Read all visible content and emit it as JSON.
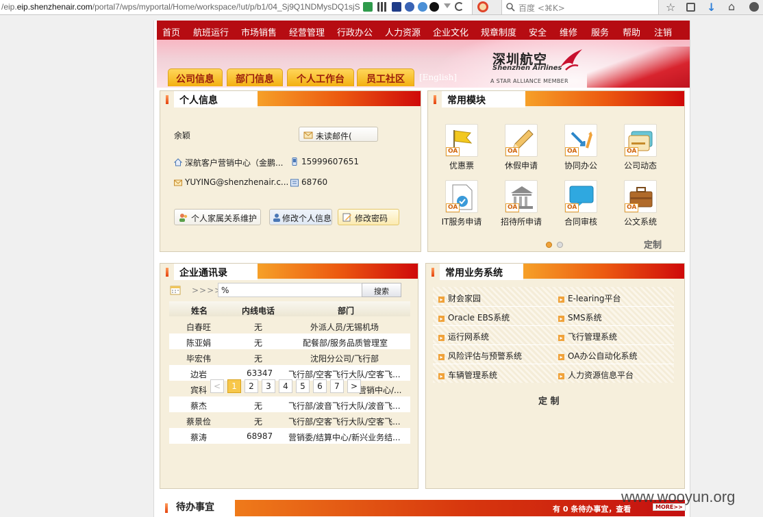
{
  "browser": {
    "url_host": "eip.shenzhenair.com",
    "url_prefix": "/eip.",
    "url_path": "/portal7/wps/myportal/Home/workspace/!ut/p/b1/04_Sj9Q1NDMysDQ1sjS",
    "search_placeholder": "百度 <⌘K>"
  },
  "nav": [
    "首页",
    "航班运行",
    "市场销售",
    "经营管理",
    "行政办公",
    "人力资源",
    "企业文化",
    "规章制度",
    "安全",
    "维修",
    "服务",
    "帮助",
    "注销"
  ],
  "banner": {
    "logo_cn": "深圳航空",
    "logo_en": "Shenzhen Airlines",
    "alliance": "A STAR ALLIANCE MEMBER",
    "tabs": [
      "公司信息",
      "部门信息",
      "个人工作台",
      "员工社区"
    ],
    "english": "[English]"
  },
  "personal": {
    "title": "个人信息",
    "name": "余颖",
    "unread_mail": "未读邮件(",
    "department": "深航客户营销中心（金鹏...",
    "mobile": "15999607651",
    "email": "YUYING@shenzhenair.c...",
    "ext": "68760",
    "buttons": [
      "个人家属关系维护",
      "修改个人信息",
      "修改密码"
    ]
  },
  "modules": {
    "title": "常用模块",
    "oa_badge": "OA",
    "items": [
      "优惠票",
      "休假申请",
      "协同办公",
      "公司动态",
      "IT服务申请",
      "招待所申请",
      "合同审核",
      "公文系统"
    ],
    "customize": "定制"
  },
  "directory": {
    "title": "企业通讯录",
    "arrows": ">>>>",
    "search_value": "%",
    "search_button": "搜索",
    "headers": [
      "姓名",
      "内线电话",
      "部门"
    ],
    "rows": [
      [
        "白春旺",
        "无",
        "外派人员/无锡机场"
      ],
      [
        "陈亚娟",
        "无",
        "配餐部/服务品质管理室"
      ],
      [
        "毕宏伟",
        "无",
        "沈阳分公司/飞行部"
      ],
      [
        "边岩",
        "63347",
        "飞行部/空客飞行大队/空客飞..."
      ],
      [
        "宾科",
        "",
        "营销中心/..."
      ],
      [
        "蔡杰",
        "无",
        "飞行部/波音飞行大队/波音飞..."
      ],
      [
        "蔡景俭",
        "无",
        "飞行部/空客飞行大队/空客飞..."
      ],
      [
        "蔡涛",
        "68987",
        "营销委/结算中心/新兴业务结..."
      ]
    ],
    "pager": [
      "<",
      "1",
      "2",
      "3",
      "4",
      "5",
      "6",
      "7",
      ">"
    ]
  },
  "business": {
    "title": "常用业务系统",
    "items": [
      "财会家园",
      "E-learing平台",
      "Oracle EBS系统",
      "SMS系统",
      "运行网系统",
      "飞行管理系统",
      "风险评估与预警系统",
      "OA办公自动化系统",
      "车辆管理系统",
      "人力资源信息平台"
    ],
    "customize": "定 制"
  },
  "todo": {
    "title": "待办事宜",
    "notice": "有 0 条待办事宜，查看",
    "more": "MORE>>"
  },
  "watermark": "www.wooyun.org"
}
